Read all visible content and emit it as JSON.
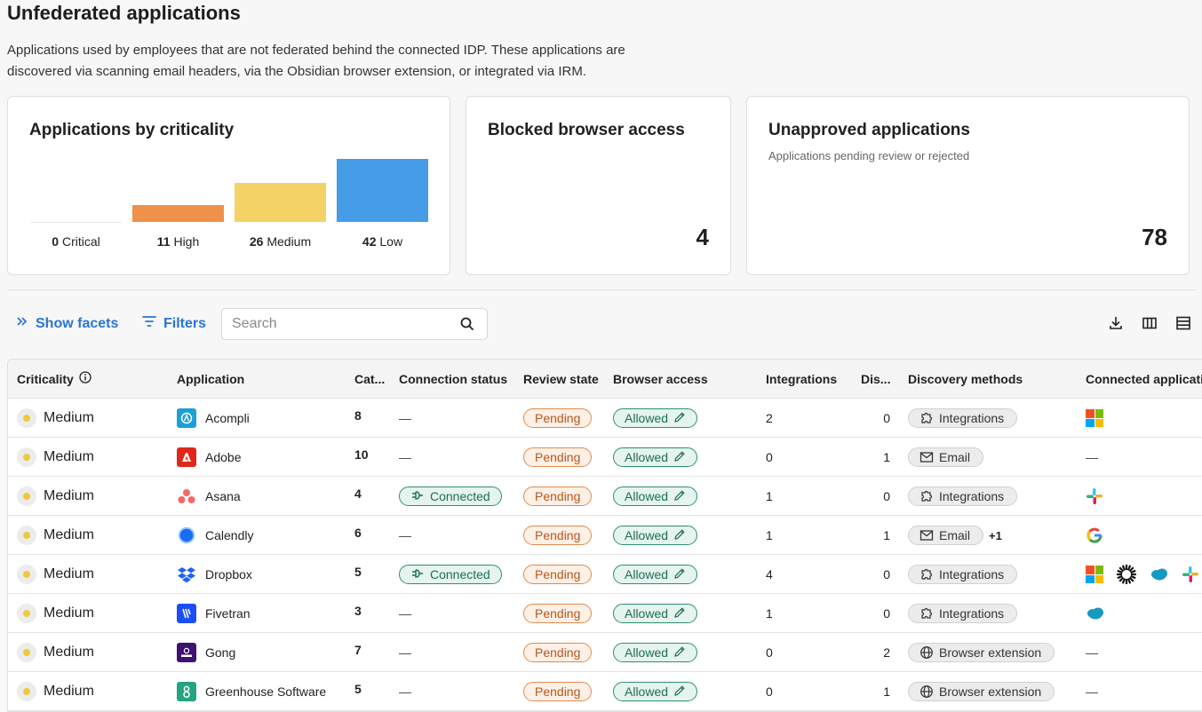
{
  "page": {
    "title": "Unfederated applications",
    "description": "Applications used by employees that are not federated behind the connected IDP. These applications are discovered via scanning email headers, via the Obsidian browser extension, or integrated via IRM."
  },
  "cards": {
    "criticality": {
      "title": "Applications by criticality",
      "items": [
        {
          "count": "0",
          "label": "Critical",
          "value": 0,
          "color": "#e5e5e5"
        },
        {
          "count": "11",
          "label": "High",
          "value": 11,
          "color": "#ef9148"
        },
        {
          "count": "26",
          "label": "Medium",
          "value": 26,
          "color": "#f4d265"
        },
        {
          "count": "42",
          "label": "Low",
          "value": 42,
          "color": "#469ce6"
        }
      ]
    },
    "blocked": {
      "title": "Blocked browser access",
      "value": "4"
    },
    "unapproved": {
      "title": "Unapproved applications",
      "subtitle": "Applications pending review or rejected",
      "value": "78"
    }
  },
  "toolbar": {
    "show_facets": "Show facets",
    "filters": "Filters",
    "search_placeholder": "Search"
  },
  "table": {
    "headers": {
      "criticality": "Criticality",
      "application": "Application",
      "category": "Cat...",
      "connection_status": "Connection status",
      "review_state": "Review state",
      "browser_access": "Browser access",
      "integrations": "Integrations",
      "dis": "Dis...",
      "discovery_methods": "Discovery methods",
      "connected_apps": "Connected applications"
    },
    "rows": [
      {
        "criticality": "Medium",
        "app": "Acompli",
        "icon": "acompli-icon",
        "category": "8",
        "connection": "—",
        "review": "Pending",
        "browser": "Allowed",
        "integrations": "2",
        "dis": "0",
        "method": "Integrations",
        "method_icon": "puzzle-icon",
        "extra": "",
        "connected": [
          "microsoft-icon"
        ]
      },
      {
        "criticality": "Medium",
        "app": "Adobe",
        "icon": "adobe-icon",
        "category": "10",
        "connection": "—",
        "review": "Pending",
        "browser": "Allowed",
        "integrations": "0",
        "dis": "1",
        "method": "Email",
        "method_icon": "mail-icon",
        "extra": "",
        "connected": []
      },
      {
        "criticality": "Medium",
        "app": "Asana",
        "icon": "asana-icon",
        "category": "4",
        "connection": "Connected",
        "review": "Pending",
        "browser": "Allowed",
        "integrations": "1",
        "dis": "0",
        "method": "Integrations",
        "method_icon": "puzzle-icon",
        "extra": "",
        "connected": [
          "slack-icon"
        ]
      },
      {
        "criticality": "Medium",
        "app": "Calendly",
        "icon": "calendly-icon",
        "category": "6",
        "connection": "—",
        "review": "Pending",
        "browser": "Allowed",
        "integrations": "1",
        "dis": "1",
        "method": "Email",
        "method_icon": "mail-icon",
        "extra": "+1",
        "connected": [
          "google-icon"
        ]
      },
      {
        "criticality": "Medium",
        "app": "Dropbox",
        "icon": "dropbox-icon",
        "category": "5",
        "connection": "Connected",
        "review": "Pending",
        "browser": "Allowed",
        "integrations": "4",
        "dis": "0",
        "method": "Integrations",
        "method_icon": "puzzle-icon",
        "extra": "",
        "connected": [
          "microsoft-icon",
          "burst-icon",
          "salesforce-icon",
          "slack-icon"
        ]
      },
      {
        "criticality": "Medium",
        "app": "Fivetran",
        "icon": "fivetran-icon",
        "category": "3",
        "connection": "—",
        "review": "Pending",
        "browser": "Allowed",
        "integrations": "1",
        "dis": "0",
        "method": "Integrations",
        "method_icon": "puzzle-icon",
        "extra": "",
        "connected": [
          "salesforce-icon"
        ]
      },
      {
        "criticality": "Medium",
        "app": "Gong",
        "icon": "gong-icon",
        "category": "7",
        "connection": "—",
        "review": "Pending",
        "browser": "Allowed",
        "integrations": "0",
        "dis": "2",
        "method": "Browser extension",
        "method_icon": "globe-icon",
        "extra": "",
        "connected": []
      },
      {
        "criticality": "Medium",
        "app": "Greenhouse Software",
        "icon": "greenhouse-icon",
        "category": "5",
        "connection": "—",
        "review": "Pending",
        "browser": "Allowed",
        "integrations": "0",
        "dis": "1",
        "method": "Browser extension",
        "method_icon": "globe-icon",
        "extra": "",
        "connected": []
      }
    ],
    "empty_dash": "—"
  },
  "colors": {
    "accent": "#2a74d6",
    "pending_border": "#e08b4e",
    "allowed_border": "#2f8f6f",
    "medium_dot": "#f0c93a"
  }
}
